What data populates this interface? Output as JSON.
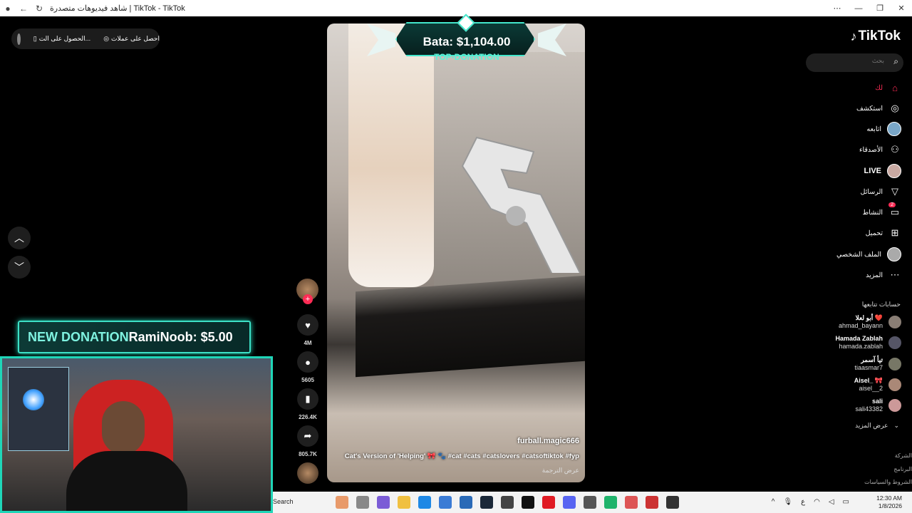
{
  "window": {
    "title": "شاهد فيديوهات متصدرة | TikTok - TikTok"
  },
  "top_buttons": {
    "coins": "احصل على عملات",
    "app": "الحصول على الت..."
  },
  "overlays": {
    "top_donation_amount": "Bata: $1,104.00",
    "top_donation_label": "TOP-DONATION",
    "new_donation_label": "NEW DONATION",
    "new_donation_text": "RamiNoob: $5.00"
  },
  "video": {
    "creator": "furball.magic666",
    "caption": "Cat's Version of 'Helping' 🎀 🐾 #cat #cats #catslovers #catsoftiktok #fyp",
    "translate": "عرض الترجمة"
  },
  "actions": {
    "likes": "4M",
    "comments": "5605",
    "saves": "226.4K",
    "shares": "805.7K"
  },
  "sidebar": {
    "logo": "TikTok",
    "search_placeholder": "بحث",
    "items": [
      {
        "label": "لك",
        "icon": "home-icon"
      },
      {
        "label": "استكشف",
        "icon": "compass-icon"
      },
      {
        "label": "اتابعه",
        "icon": "avatar-icon"
      },
      {
        "label": "الأصدقاء",
        "icon": "friends-icon"
      },
      {
        "label": "LIVE",
        "icon": "live-avatar-icon"
      },
      {
        "label": "الرسائل",
        "icon": "send-icon"
      },
      {
        "label": "النشاط",
        "icon": "activity-icon",
        "badge": "2"
      },
      {
        "label": "تحميل",
        "icon": "upload-icon"
      },
      {
        "label": "الملف الشخصي",
        "icon": "profile-icon"
      },
      {
        "label": "المزيد",
        "icon": "more-icon"
      }
    ],
    "following_title": "حسابات تتابعها",
    "following": [
      {
        "name": "أبو لعلا ❤️",
        "username": "ahmad_bayann"
      },
      {
        "name": "Hamada Zablah",
        "username": "hamada.zablah"
      },
      {
        "name": "تيأ آسمر",
        "username": "tiaasmar7"
      },
      {
        "name": "Aisel_ 🎀",
        "username": "aisel__2"
      },
      {
        "name": "sali",
        "username": "sali43382"
      }
    ],
    "show_more": "عرض المزيد",
    "footer": [
      "الشركة",
      "البرنامج",
      "الشروط والسياسات"
    ]
  },
  "taskbar": {
    "search": "Search",
    "time": "12:30 AM",
    "date": "1/8/2026",
    "lang": "ع"
  }
}
